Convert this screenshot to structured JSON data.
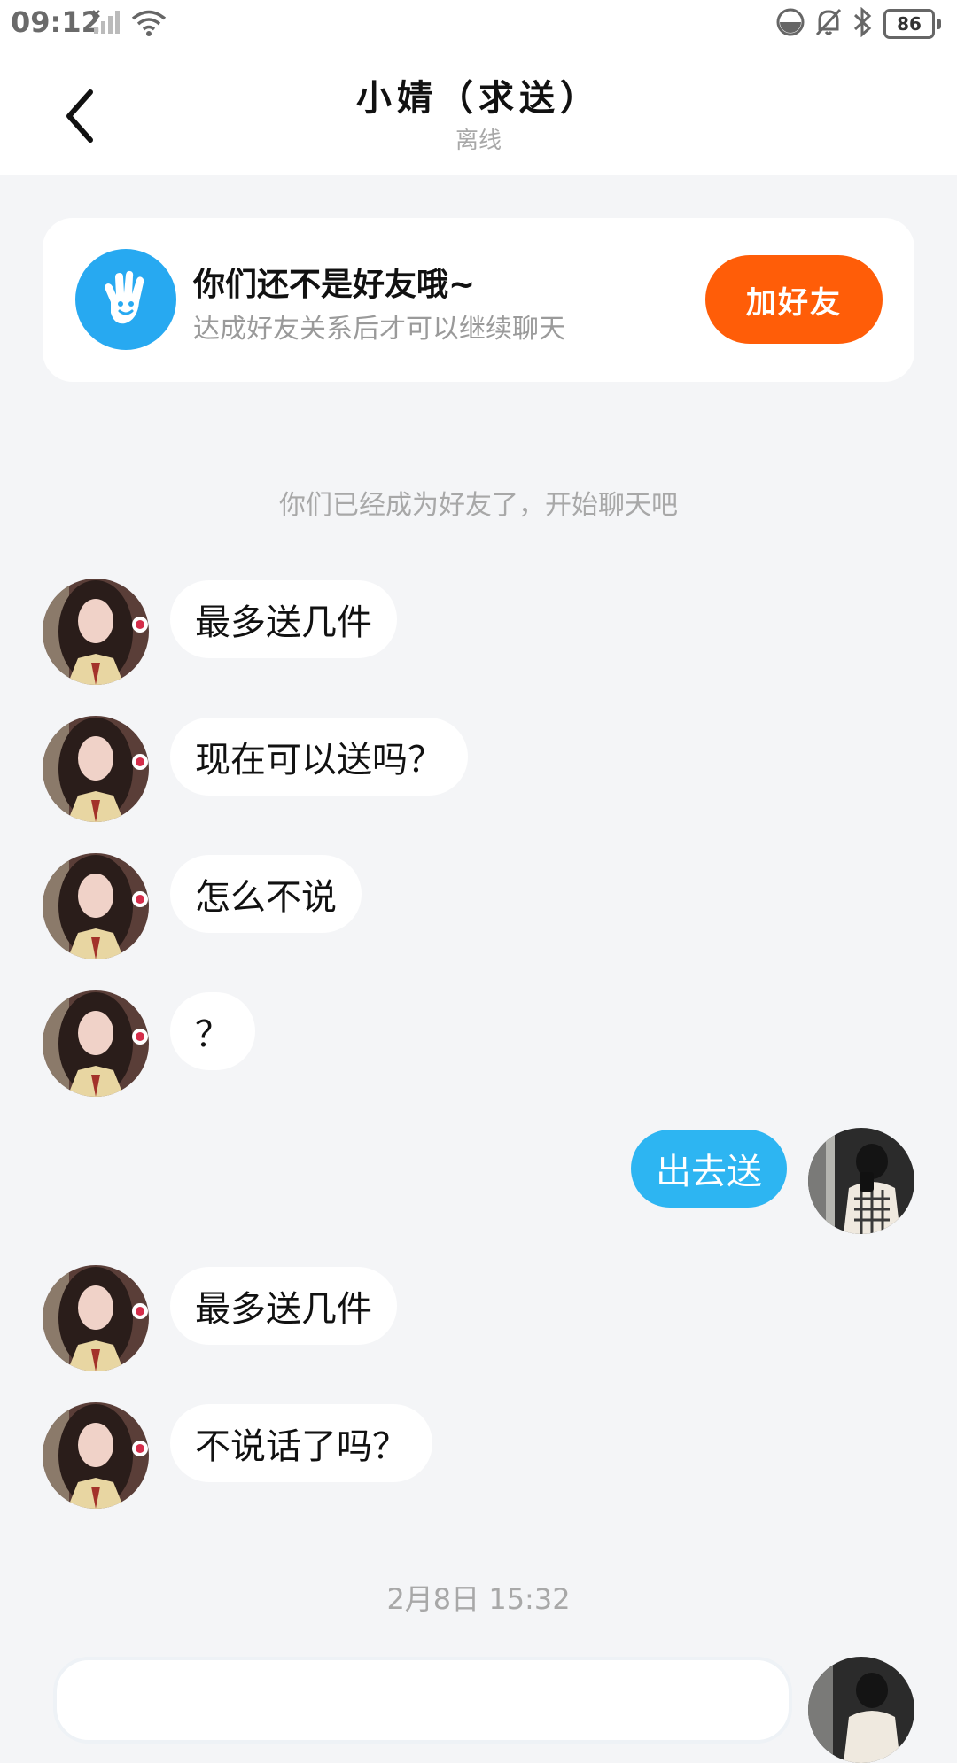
{
  "status_bar": {
    "time": "09:12",
    "battery": "86",
    "icons": [
      "no-signal-icon",
      "wifi-icon",
      "data-saver-icon",
      "bell-off-icon",
      "bluetooth-icon",
      "battery-icon"
    ]
  },
  "header": {
    "title": "小婧（求送）",
    "subtitle": "离线"
  },
  "friend_card": {
    "title": "你们还不是好友哦~",
    "subtitle": "达成好友关系后才可以继续聊天",
    "button_label": "加好友",
    "accent_color": "#ff5d08",
    "icon_color": "#27a9f1"
  },
  "system_message": "你们已经成为好友了，开始聊天吧",
  "messages": [
    {
      "side": "left",
      "text": "最多送几件"
    },
    {
      "side": "left",
      "text": "现在可以送吗？"
    },
    {
      "side": "left",
      "text": "怎么不说"
    },
    {
      "side": "left",
      "text": "？"
    },
    {
      "side": "right",
      "text": "出去送"
    },
    {
      "side": "left",
      "text": "最多送几件"
    },
    {
      "side": "left",
      "text": "不说话了吗？"
    }
  ],
  "timestamp": "2月8日 15:32",
  "colors": {
    "background": "#f4f5f7",
    "self_bubble": "#2db5f2",
    "other_bubble": "#ffffff"
  }
}
